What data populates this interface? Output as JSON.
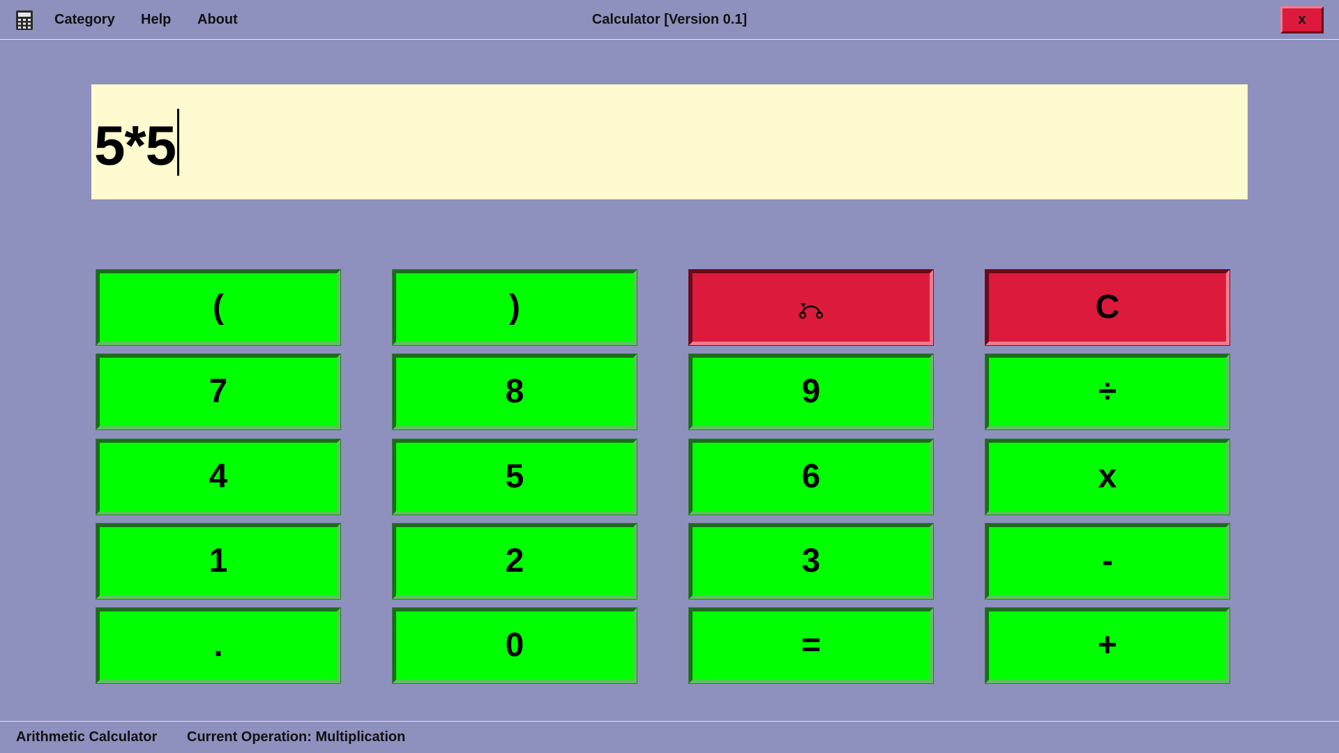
{
  "app": {
    "title": "Calculator [Version 0.1]",
    "icon": "calculator-icon",
    "close_label": "x"
  },
  "menu": {
    "category": "Category",
    "help": "Help",
    "about": "About"
  },
  "display": {
    "value": "5*5"
  },
  "keys": {
    "open_paren": "(",
    "close_paren": ")",
    "backspace_icon": "backspace-undo-icon",
    "clear": "C",
    "seven": "7",
    "eight": "8",
    "nine": "9",
    "divide": "÷",
    "four": "4",
    "five": "5",
    "six": "6",
    "multiply": "x",
    "one": "1",
    "two": "2",
    "three": "3",
    "minus": "-",
    "dot": ".",
    "zero": "0",
    "equals": "=",
    "plus": "+"
  },
  "status": {
    "mode": "Arithmetic Calculator",
    "operation": "Current Operation: Multiplication"
  },
  "colors": {
    "background": "#8e90be",
    "key_green": "#00ff00",
    "key_red": "#dc1a3c",
    "display_bg": "#fefbd0"
  }
}
